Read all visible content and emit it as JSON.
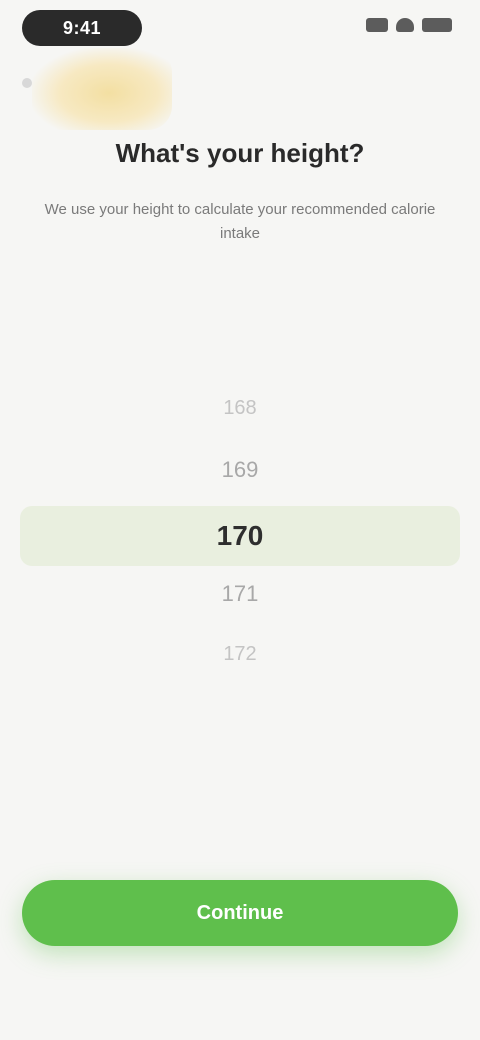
{
  "status_bar": {
    "time": "9:41"
  },
  "header": {
    "title": "What's your height?",
    "subtitle": "We use your height to calculate your recommended calorie intake"
  },
  "picker": {
    "unit_label": "",
    "items": [
      "168",
      "169",
      "170",
      "171",
      "172"
    ],
    "selected_index": 2
  },
  "footer": {
    "continue_label": "Continue"
  },
  "colors": {
    "accent": "#5fbf4c",
    "highlight": "#e9efdf",
    "background": "#f6f6f4"
  }
}
